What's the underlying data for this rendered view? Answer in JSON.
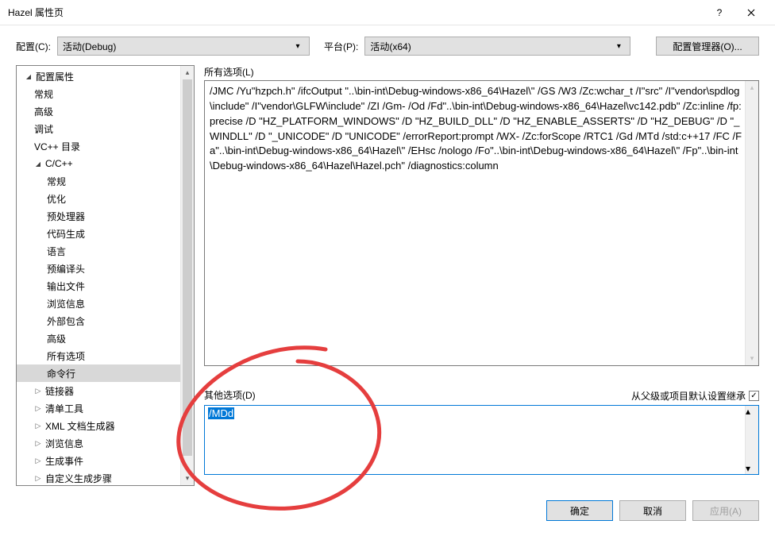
{
  "window": {
    "title": "Hazel 属性页"
  },
  "toolbar": {
    "config_label": "配置(C):",
    "config_value": "活动(Debug)",
    "platform_label": "平台(P):",
    "platform_value": "活动(x64)",
    "manager_label": "配置管理器(O)..."
  },
  "tree": {
    "root": "配置属性",
    "items_l1": [
      "常规",
      "高级",
      "调试",
      "VC++ 目录"
    ],
    "cpp": "C/C++",
    "cpp_items": [
      "常规",
      "优化",
      "预处理器",
      "代码生成",
      "语言",
      "预编译头",
      "输出文件",
      "浏览信息",
      "外部包含",
      "高级",
      "所有选项",
      "命令行"
    ],
    "items_after": [
      "链接器",
      "清单工具",
      "XML 文档生成器",
      "浏览信息",
      "生成事件",
      "自定义生成步骤"
    ]
  },
  "panel": {
    "all_options_label": "所有选项(L)",
    "all_options_text": "/JMC /Yu\"hzpch.h\" /ifcOutput \"..\\bin-int\\Debug-windows-x86_64\\Hazel\\\" /GS /W3 /Zc:wchar_t /I\"src\" /I\"vendor\\spdlog\\include\" /I\"vendor\\GLFW\\include\" /ZI /Gm- /Od /Fd\"..\\bin-int\\Debug-windows-x86_64\\Hazel\\vc142.pdb\" /Zc:inline /fp:precise /D \"HZ_PLATFORM_WINDOWS\" /D \"HZ_BUILD_DLL\" /D \"HZ_ENABLE_ASSERTS\" /D \"HZ_DEBUG\" /D \"_WINDLL\" /D \"_UNICODE\" /D \"UNICODE\" /errorReport:prompt /WX- /Zc:forScope /RTC1 /Gd /MTd /std:c++17 /FC /Fa\"..\\bin-int\\Debug-windows-x86_64\\Hazel\\\" /EHsc /nologo /Fo\"..\\bin-int\\Debug-windows-x86_64\\Hazel\\\" /Fp\"..\\bin-int\\Debug-windows-x86_64\\Hazel\\Hazel.pch\" /diagnostics:column ",
    "other_label": "其他选项(D)",
    "inherit_label": "从父级或项目默认设置继承",
    "other_value": "/MDd"
  },
  "buttons": {
    "ok": "确定",
    "cancel": "取消",
    "apply": "应用(A)"
  }
}
